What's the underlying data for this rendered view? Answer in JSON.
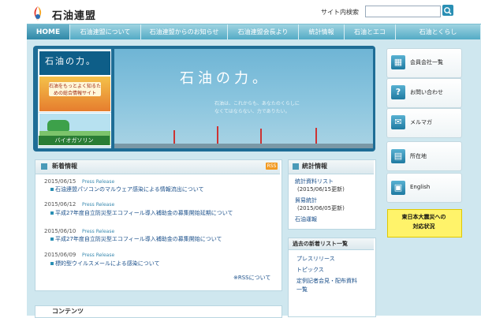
{
  "header": {
    "logo_text": "石油連盟",
    "search_label": "サイト内検索",
    "search_placeholder": ""
  },
  "nav": [
    {
      "label": "HOME",
      "active": true
    },
    {
      "label": "石油連盟について"
    },
    {
      "label": "石油連盟からのお知らせ"
    },
    {
      "label": "石油連盟会長より"
    },
    {
      "label": "統計情報"
    },
    {
      "label": "石油とエコ"
    },
    {
      "label": "石油とくらし"
    }
  ],
  "hero": {
    "thumb1_text": "石油の力。",
    "thumb2_text": "石油をもっとよく知るための総合情報サイト",
    "thumb3_text": "バイオガソリン",
    "title": "石油の力。",
    "sub_line1": "石油は、これからも、あなたのくらしに",
    "sub_line2": "なくてはならない、力でありたい。"
  },
  "news": {
    "title": "新着情報",
    "rss": "RSS",
    "items": [
      {
        "date": "2015/06/15",
        "tag": "Press Release",
        "text": "石油連盟パソコンのマルウェア感染による情報流出について"
      },
      {
        "date": "2015/06/12",
        "tag": "Press Release",
        "text": "平成27年度自立防災型エコフィール導入補助金の募集開始延期について"
      },
      {
        "date": "2015/06/10",
        "tag": "Press Release",
        "text": "平成27年度自立防災型エコフィール導入補助金の募集開始について"
      },
      {
        "date": "2015/06/09",
        "tag": "Press Release",
        "text": "標的型ウイルスメールによる感染について"
      }
    ],
    "more": "※RSSについて"
  },
  "stats": {
    "title": "統計情報",
    "items": [
      {
        "link": "統計資料リスト",
        "sub": "(2015/06/15更新)"
      },
      {
        "link": "貿易統計",
        "sub": "(2015/06/05更新)"
      },
      {
        "link": "石油運報",
        "sub": ""
      }
    ]
  },
  "past": {
    "title": "過去の新着リスト一覧",
    "items": [
      "プレスリリース",
      "トピックス",
      "定例記者会見・配布資料",
      "一覧"
    ]
  },
  "sidebar": [
    {
      "label": "会員会社一覧",
      "icon": "building-icon",
      "glyph": "▦"
    },
    {
      "label": "お問い合わせ",
      "icon": "question-icon",
      "glyph": "?"
    },
    {
      "label": "メルマガ",
      "icon": "mail-icon",
      "glyph": "✉"
    },
    {
      "label": "所在地",
      "icon": "map-icon",
      "glyph": "▤"
    },
    {
      "label": "English",
      "icon": "english-icon",
      "glyph": "▣"
    }
  ],
  "quake": {
    "line1": "東日本大震災への",
    "line2": "対応状況"
  },
  "contents": {
    "title": "コンテンツ"
  },
  "colors": {
    "nav_bar": "#4fa9c4",
    "link": "#1a4f8a",
    "quake_bg": "#fff36a",
    "rss": "#f29a22"
  }
}
